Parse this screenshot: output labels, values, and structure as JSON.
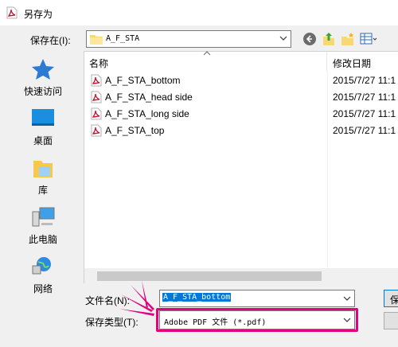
{
  "dialog": {
    "title": "另存为"
  },
  "toolbar": {
    "save_in_label": "保存在(I):",
    "save_in_value": "A_F_STA",
    "icons": [
      "back-icon",
      "up-folder-icon",
      "new-folder-icon",
      "view-menu-icon"
    ]
  },
  "places": [
    {
      "label": "快速访问",
      "icon": "star-icon"
    },
    {
      "label": "桌面",
      "icon": "desktop-icon"
    },
    {
      "label": "库",
      "icon": "library-icon"
    },
    {
      "label": "此电脑",
      "icon": "computer-icon"
    },
    {
      "label": "网络",
      "icon": "network-icon"
    }
  ],
  "file_list": {
    "columns": {
      "name": "名称",
      "date": "修改日期"
    },
    "files": [
      {
        "name": "A_F_STA_bottom",
        "date": "2015/7/27 11:1"
      },
      {
        "name": "A_F_STA_head side",
        "date": "2015/7/27 11:1"
      },
      {
        "name": "A_F_STA_long side",
        "date": "2015/7/27 11:1"
      },
      {
        "name": "A_F_STA_top",
        "date": "2015/7/27 11:1"
      }
    ]
  },
  "form": {
    "filename_label": "文件名(N):",
    "filename_value": "A_F_STA_bottom",
    "filetype_label": "保存类型(T):",
    "filetype_value": "Adobe PDF 文件 (*.pdf)",
    "save_button": "保"
  },
  "colors": {
    "highlight": "#e5007e",
    "selection": "#0078d7",
    "pdf_red": "#c8102e"
  }
}
